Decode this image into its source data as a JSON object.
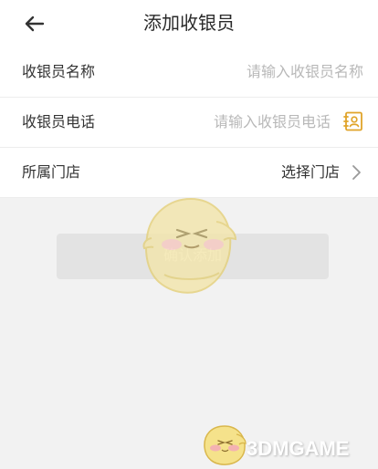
{
  "header": {
    "title": "添加收银员"
  },
  "form": {
    "name_label": "收银员名称",
    "name_placeholder": "请输入收银员名称",
    "phone_label": "收银员电话",
    "phone_placeholder": "请输入收银员电话",
    "store_label": "所属门店",
    "store_value": "选择门店"
  },
  "actions": {
    "confirm_label": "确认添加"
  },
  "watermark": {
    "brand_text": "3DMGAME"
  },
  "icons": {
    "back": "arrow-left-icon",
    "contact": "contact-book-icon",
    "chevron": "chevron-right-icon"
  },
  "colors": {
    "accent": "#E0A42A",
    "button_bg": "#E3E3E3",
    "placeholder": "#B8B8B8"
  }
}
